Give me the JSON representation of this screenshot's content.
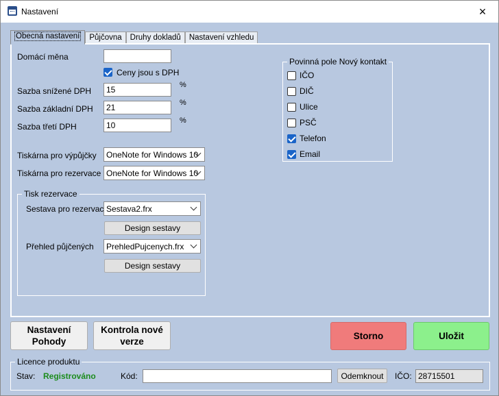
{
  "window": {
    "title": "Nastavení",
    "close_icon": "×"
  },
  "tabs": [
    {
      "label": "Obecná nastavení"
    },
    {
      "label": "Půjčovna"
    },
    {
      "label": "Druhy dokladů"
    },
    {
      "label": "Nastavení vzhledu"
    }
  ],
  "general": {
    "home_currency_label": "Domácí měna",
    "home_currency_value": "",
    "prices_with_vat_label": "Ceny jsou s DPH",
    "prices_with_vat_checked": true,
    "vat_reduced_label": "Sazba snížené DPH",
    "vat_reduced_value": "15",
    "vat_basic_label": "Sazba základní DPH",
    "vat_basic_value": "21",
    "vat_third_label": "Sazba třetí DPH",
    "vat_third_value": "10",
    "percent": "%",
    "printer_loans_label": "Tiskárna pro výpůjčky",
    "printer_loans_value": "OneNote for Windows 10",
    "printer_reservations_label": "Tiskárna pro rezervace",
    "printer_reservations_value": "OneNote for Windows 10"
  },
  "print_reservation": {
    "title": "Tisk rezervace",
    "report_label": "Sestava pro rezervaci",
    "report_value": "Sestava2.frx",
    "design_button": "Design sestavy",
    "overview_label": "Přehled půjčených",
    "overview_value": "PrehledPujcenych.frx",
    "design_button_2": "Design sestavy"
  },
  "required_fields": {
    "title": "Povinná pole Nový kontakt",
    "items": [
      {
        "label": "IČO",
        "checked": false
      },
      {
        "label": "DIČ",
        "checked": false
      },
      {
        "label": "Ulice",
        "checked": false
      },
      {
        "label": "PSČ",
        "checked": false
      },
      {
        "label": "Telefon",
        "checked": true
      },
      {
        "label": "Email",
        "checked": true
      }
    ]
  },
  "buttons": {
    "pohoda": "Nastavení Pohody",
    "check_version": "Kontrola nové verze",
    "cancel": "Storno",
    "save": "Uložit"
  },
  "license": {
    "title": "Licence produktu",
    "status_label": "Stav:",
    "status_value": "Registrováno",
    "code_label": "Kód:",
    "code_value": "",
    "unlock_button": "Odemknout",
    "ico_label": "IČO:",
    "ico_value": "28715501"
  },
  "colors": {
    "background": "#b8c8e0",
    "cancel": "#f07b7b",
    "save": "#8cf08c",
    "status_ok": "#1c8c1c",
    "checkbox": "#1a64c8"
  }
}
